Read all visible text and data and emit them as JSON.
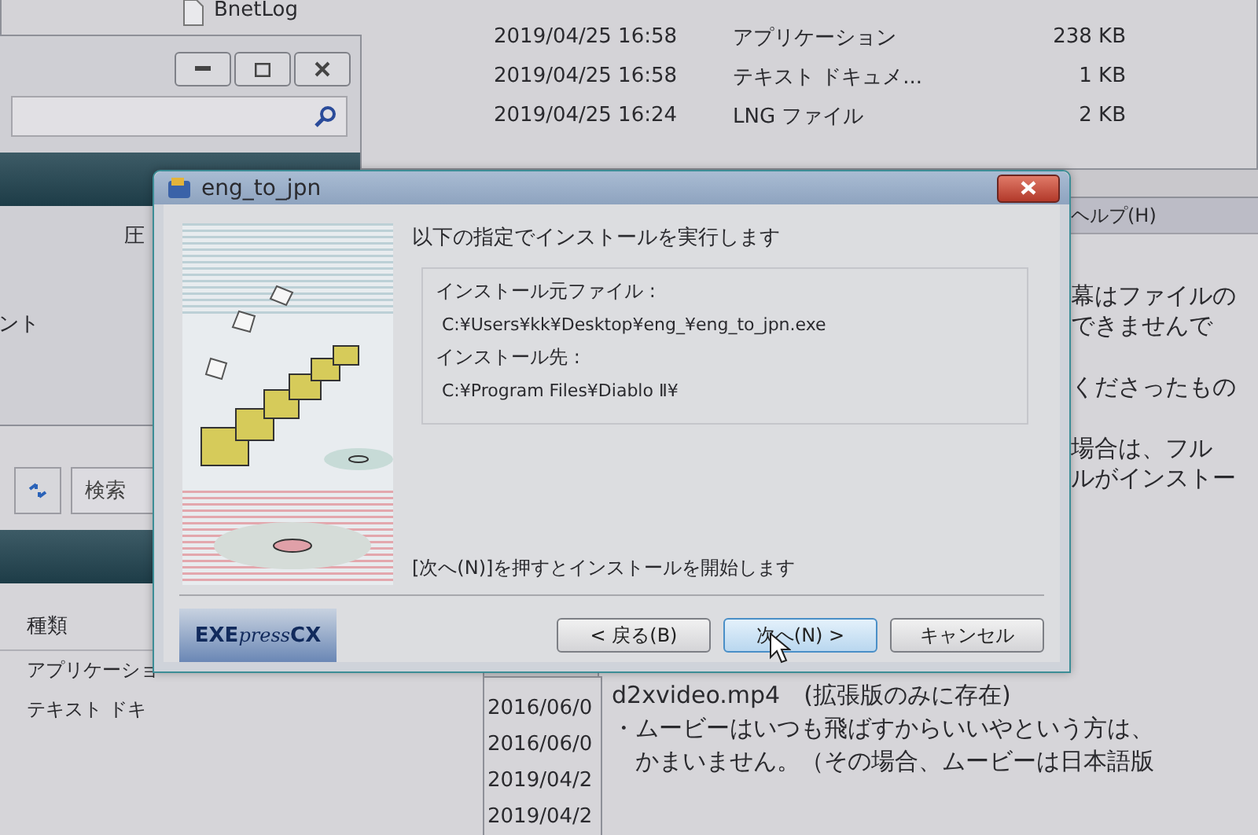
{
  "back_explorer": {
    "nav_item": "BnetLog",
    "rows": [
      {
        "date": "2019/04/25 16:58",
        "type": "アプリケーション",
        "size": "238 KB"
      },
      {
        "date": "2019/04/25 16:58",
        "type": "テキスト ドキュメ...",
        "size": "1 KB"
      },
      {
        "date": "2019/04/25 16:24",
        "type": "LNG ファイル",
        "size": "2 KB"
      }
    ]
  },
  "left_window": {
    "fragments": [
      "圧",
      "ント"
    ]
  },
  "left_lower_window": {
    "search_placeholder": "検索",
    "column": "種類",
    "rows": [
      "アプリケーショ",
      "テキスト ドキ"
    ]
  },
  "date_column": [
    "2016/06/0",
    "2016/06/0",
    "2019/04/2",
    "2019/04/2"
  ],
  "text_window": {
    "menu": "ヘルプ(H)",
    "upper_paragraphs": [
      [
        "幕はファイルの",
        "できませんで"
      ],
      [
        "くださったもの"
      ],
      [
        "場合は、フル",
        "ルがインストー"
      ]
    ],
    "lower_lines": [
      "d2xvideo.mp4　(拡張版のみに存在)",
      "・ムービーはいつも飛ばすからいいやという方は、",
      "　かまいません。（その場合、ムービーは日本語版"
    ]
  },
  "dialog": {
    "title": "eng_to_jpn",
    "heading": "以下の指定でインストールを実行します",
    "fields": [
      {
        "label": "インストール元ファイル :",
        "value": "C:¥Users¥kk¥Desktop¥eng_¥eng_to_jpn.exe"
      },
      {
        "label": "インストール先 :",
        "value": "C:¥Program Files¥Diablo Ⅱ¥"
      }
    ],
    "hint": "[次へ(N)]を押すとインストールを開始します",
    "logo": {
      "main": "EXE",
      "script": "press",
      "suffix": "CX"
    },
    "buttons": [
      {
        "label": "< 戻る(B)",
        "default": false
      },
      {
        "label": "次へ(N) >",
        "default": true
      },
      {
        "label": "キャンセル",
        "default": false
      }
    ]
  }
}
